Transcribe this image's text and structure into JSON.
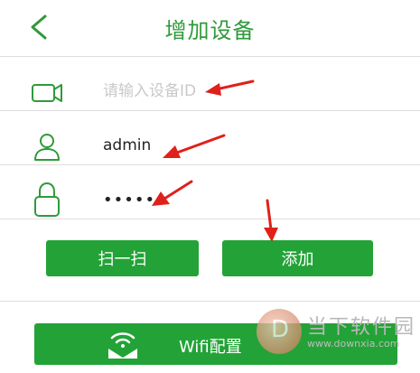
{
  "header": {
    "title": "增加设备"
  },
  "form": {
    "device_id_placeholder": "请输入设备ID",
    "username_value": "admin",
    "password_value": "••••••"
  },
  "buttons": {
    "scan_label": "扫一扫",
    "add_label": "添加",
    "wifi_label": "Wifi配置"
  },
  "watermark": {
    "text": "当下软件园",
    "url": "www.downxia.com"
  },
  "colors": {
    "accent": "#2f9a3a",
    "button": "#23a337",
    "annotation": "#e0201a"
  }
}
